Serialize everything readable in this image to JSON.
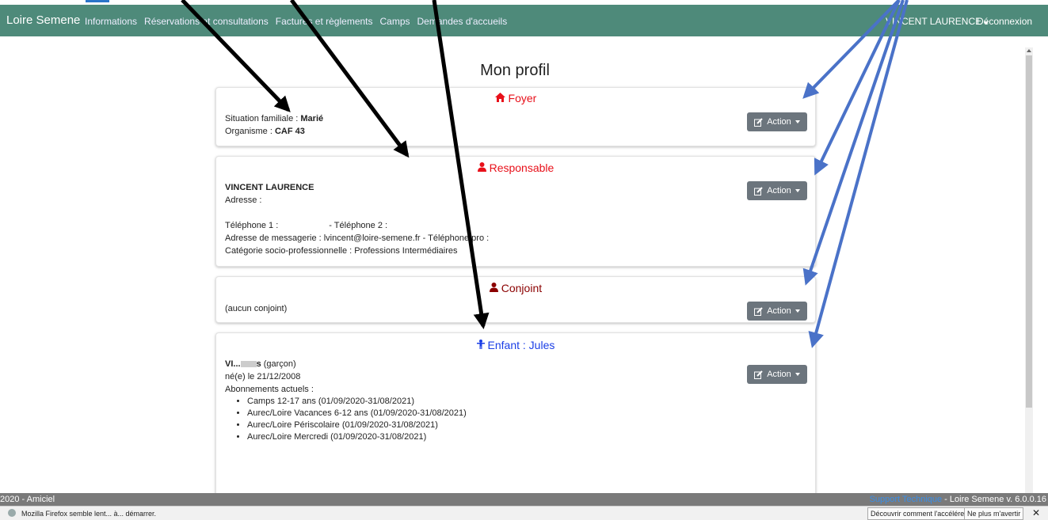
{
  "navbar": {
    "brand": "Loire Semene",
    "menu": [
      "Informations",
      "Réservations et consultations",
      "Factures et règlements",
      "Camps",
      "Demandes d'accueils"
    ],
    "user": "VINCENT LAURENCE",
    "logout": "Déconnexion"
  },
  "page_title": "Mon profil",
  "colors": {
    "navbar": "#4e8a7a",
    "red": "#e8101a",
    "darkred": "#8b0000",
    "blue": "#1a3ee6",
    "button": "#6c757d"
  },
  "cards": {
    "foyer": {
      "title": "Foyer",
      "icon": "home-icon",
      "situation_label": "Situation familiale : ",
      "situation_value": "Marié",
      "organisme_label": "Organisme : ",
      "organisme_value": "CAF 43"
    },
    "responsable": {
      "title": "Responsable",
      "icon": "user-icon",
      "name": "VINCENT LAURENCE",
      "adresse": "Adresse :",
      "telephone1": "Téléphone 1 :",
      "telephone2": "- Téléphone 2 :",
      "email_line": "Adresse de messagerie : lvincent@loire-semene.fr - Téléphone pro :",
      "categorie": "Catégorie socio-professionnelle : Professions Intermédiaires"
    },
    "conjoint": {
      "title": "Conjoint",
      "icon": "user-icon",
      "text": "(aucun conjoint)"
    },
    "enfant": {
      "title": "Enfant : Jules",
      "icon": "child-icon",
      "name_prefix": "VI...",
      "name_suffix": "s",
      "gender": " (garçon)",
      "birth": "né(e) le 21/12/2008",
      "abonnements_label": "Abonnements actuels :",
      "abonnements": [
        "Camps 12-17 ans (01/09/2020-31/08/2021)",
        "Aurec/Loire Vacances 6-12 ans (01/09/2020-31/08/2021)",
        "Aurec/Loire Périscolaire (01/09/2020-31/08/2021)",
        "Aurec/Loire Mercredi (01/09/2020-31/08/2021)"
      ]
    }
  },
  "action_label": "Action",
  "footer": {
    "copyright": "2020 - Amiciel",
    "support": "Support Technique",
    "version": " - Loire Semene v. 6.0.0.16"
  },
  "firefox_bar": {
    "message": "Mozilla Firefox semble lent... à... démarrer.",
    "button1": "Découvrir comment l'accélérer",
    "button2": "Ne plus m'avertir",
    "close": "✕"
  }
}
